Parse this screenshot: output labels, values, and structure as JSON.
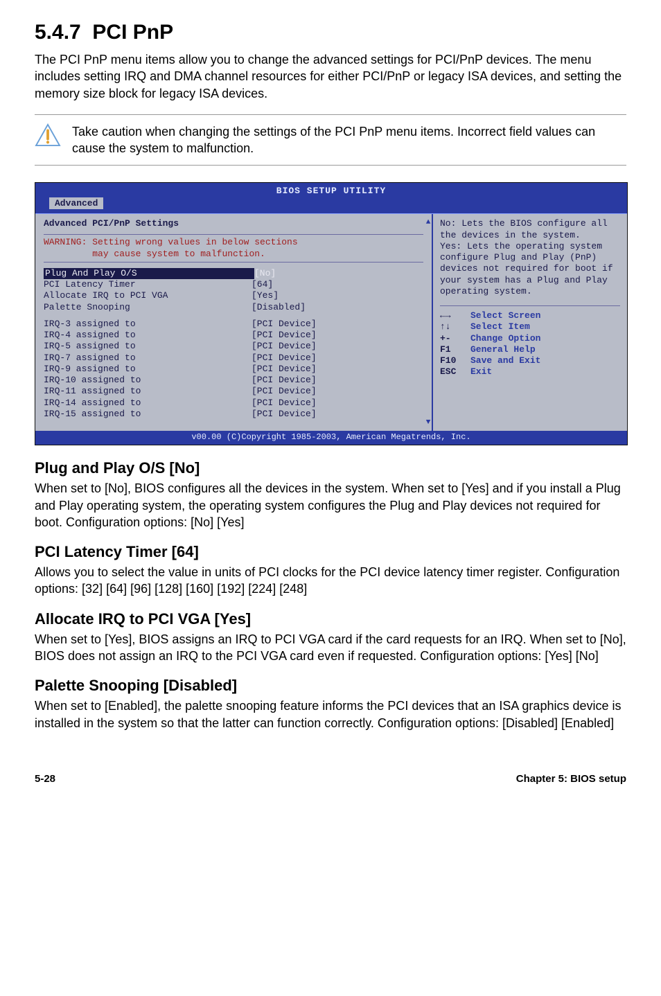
{
  "section": {
    "number": "5.4.7",
    "title": "PCI PnP",
    "intro": "The PCI PnP menu items allow you to change the advanced settings for PCI/PnP devices. The menu includes setting IRQ and DMA channel resources for either PCI/PnP or legacy ISA devices, and setting the memory size block for legacy ISA devices."
  },
  "note": {
    "text": "Take caution when changing the settings of the PCI PnP menu items. Incorrect field values can cause the system to malfunction."
  },
  "bios": {
    "title": "BIOS SETUP UTILITY",
    "tab": "Advanced",
    "panel_title": "Advanced PCI/PnP Settings",
    "warning": "WARNING: Setting wrong values in below sections\n         may cause system to malfunction.",
    "settings_top": [
      {
        "label": "Plug And Play O/S",
        "value": "[No]",
        "selected": true
      },
      {
        "label": "PCI Latency Timer",
        "value": "[64]"
      },
      {
        "label": "Allocate IRQ to PCI VGA",
        "value": "[Yes]"
      },
      {
        "label": "Palette Snooping",
        "value": "[Disabled]"
      }
    ],
    "settings_irq": [
      {
        "label": "IRQ-3 assigned to",
        "value": "[PCI Device]"
      },
      {
        "label": "IRQ-4 assigned to",
        "value": "[PCI Device]"
      },
      {
        "label": "IRQ-5 assigned to",
        "value": "[PCI Device]"
      },
      {
        "label": "IRQ-7 assigned to",
        "value": "[PCI Device]"
      },
      {
        "label": "IRQ-9 assigned to",
        "value": "[PCI Device]"
      },
      {
        "label": "IRQ-10 assigned to",
        "value": "[PCI Device]"
      },
      {
        "label": "IRQ-11 assigned to",
        "value": "[PCI Device]"
      },
      {
        "label": "IRQ-14 assigned to",
        "value": "[PCI Device]"
      },
      {
        "label": "IRQ-15 assigned to",
        "value": "[PCI Device]"
      }
    ],
    "help": "No: Lets the BIOS configure all the devices in the system.\nYes: Lets the operating system configure Plug and Play (PnP) devices not required for boot if your system has a Plug and Play operating system.",
    "keys": [
      {
        "key": "←→",
        "desc": "Select Screen"
      },
      {
        "key": "↑↓",
        "desc": "Select Item"
      },
      {
        "key": "+-",
        "desc": "Change Option"
      },
      {
        "key": "F1",
        "desc": "General Help"
      },
      {
        "key": "F10",
        "desc": "Save and Exit"
      },
      {
        "key": "ESC",
        "desc": "Exit"
      }
    ],
    "footer": "v00.00 (C)Copyright 1985-2003, American Megatrends, Inc."
  },
  "subs": [
    {
      "heading": "Plug and Play O/S [No]",
      "body": "When set to [No], BIOS configures all the devices in the system. When set to [Yes] and if you install a Plug and Play operating system, the operating system configures the Plug and Play devices not required for boot. Configuration options: [No] [Yes]"
    },
    {
      "heading": "PCI Latency Timer [64]",
      "body": "Allows you to select the value in units of PCI clocks for the PCI device latency timer register. Configuration options: [32] [64] [96] [128] [160] [192] [224] [248]"
    },
    {
      "heading": "Allocate IRQ to PCI VGA [Yes]",
      "body": "When set to [Yes], BIOS assigns an IRQ to PCI VGA card if the card requests for an IRQ. When set to [No], BIOS does not assign an IRQ to the PCI VGA card even if requested. Configuration options: [Yes] [No]"
    },
    {
      "heading": "Palette Snooping [Disabled]",
      "body": "When set to [Enabled], the palette snooping feature informs the PCI devices that an ISA graphics device is installed in the system so that the latter can function correctly. Configuration options: [Disabled] [Enabled]"
    }
  ],
  "footer": {
    "page": "5-28",
    "chapter": "Chapter 5: BIOS setup"
  }
}
